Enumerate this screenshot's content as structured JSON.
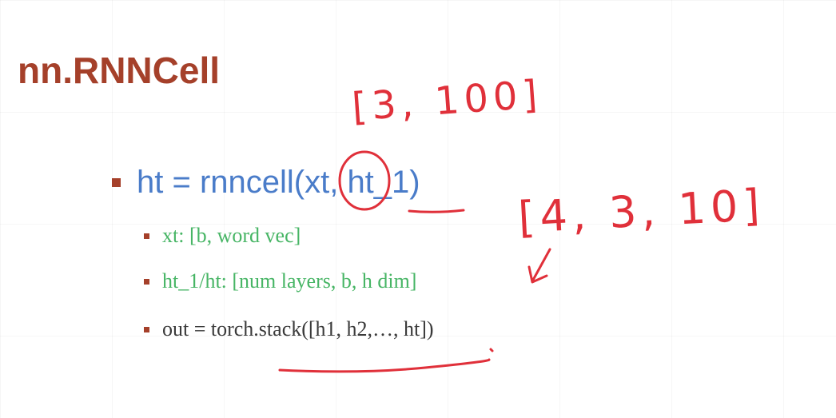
{
  "slide": {
    "title": "nn.RNNCell",
    "main_bullet": "ht = rnncell(xt, ht_1)",
    "sub_bullets": [
      "xt: [b, word vec]",
      "ht_1/ht: [num layers, b, h dim]",
      "out = torch.stack([h1, h2,…, ht])"
    ]
  },
  "colors": {
    "title": "#a5402a",
    "main_text": "#4a7cc9",
    "green_text": "#47b565",
    "dark_text": "#3a3a3a",
    "bullet_marker": "#a5402a",
    "ink": "#e0303a"
  },
  "annotations": {
    "top": "[3, 100]",
    "right": "[4, 3, 10]"
  }
}
